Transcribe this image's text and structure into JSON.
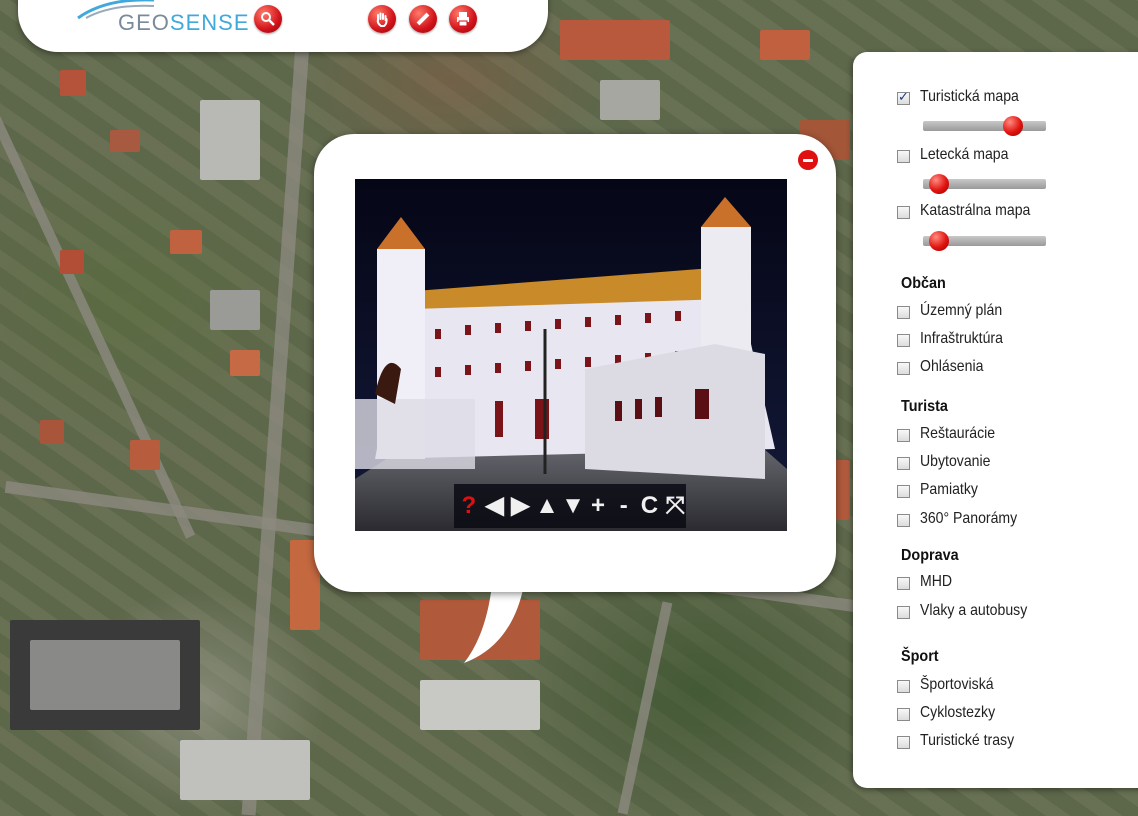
{
  "header": {
    "logo_geo": "GEO",
    "logo_sense": "SENSE",
    "tools": [
      "search-icon",
      "hand-icon",
      "ruler-icon",
      "print-icon"
    ]
  },
  "popup": {
    "pano_controls": [
      "?",
      "◀",
      "▶",
      "▲",
      "▼",
      "+",
      "-",
      "C",
      "⤧"
    ]
  },
  "layers": {
    "base": [
      {
        "label": "Turistická mapa",
        "checked": true,
        "opacity": 0.75
      },
      {
        "label": "Letecká mapa",
        "checked": false,
        "opacity": 0.1
      },
      {
        "label": "Katastrálna mapa",
        "checked": false,
        "opacity": 0.1
      }
    ],
    "groups": [
      {
        "title": "Občan",
        "items": [
          "Územný plán",
          "Infraštruktúra",
          "Ohlásenia"
        ]
      },
      {
        "title": "Turista",
        "items": [
          "Reštaurácie",
          "Ubytovanie",
          "Pamiatky",
          "360° Panorámy"
        ]
      },
      {
        "title": "Doprava",
        "items": [
          "MHD",
          "Vlaky a autobusy"
        ]
      },
      {
        "title": "Šport",
        "items": [
          "Športoviská",
          "Cyklostezky",
          "Turistické trasy"
        ]
      }
    ]
  },
  "colors": {
    "accent": "#e0140f",
    "brand_blue": "#3fa9dc"
  }
}
